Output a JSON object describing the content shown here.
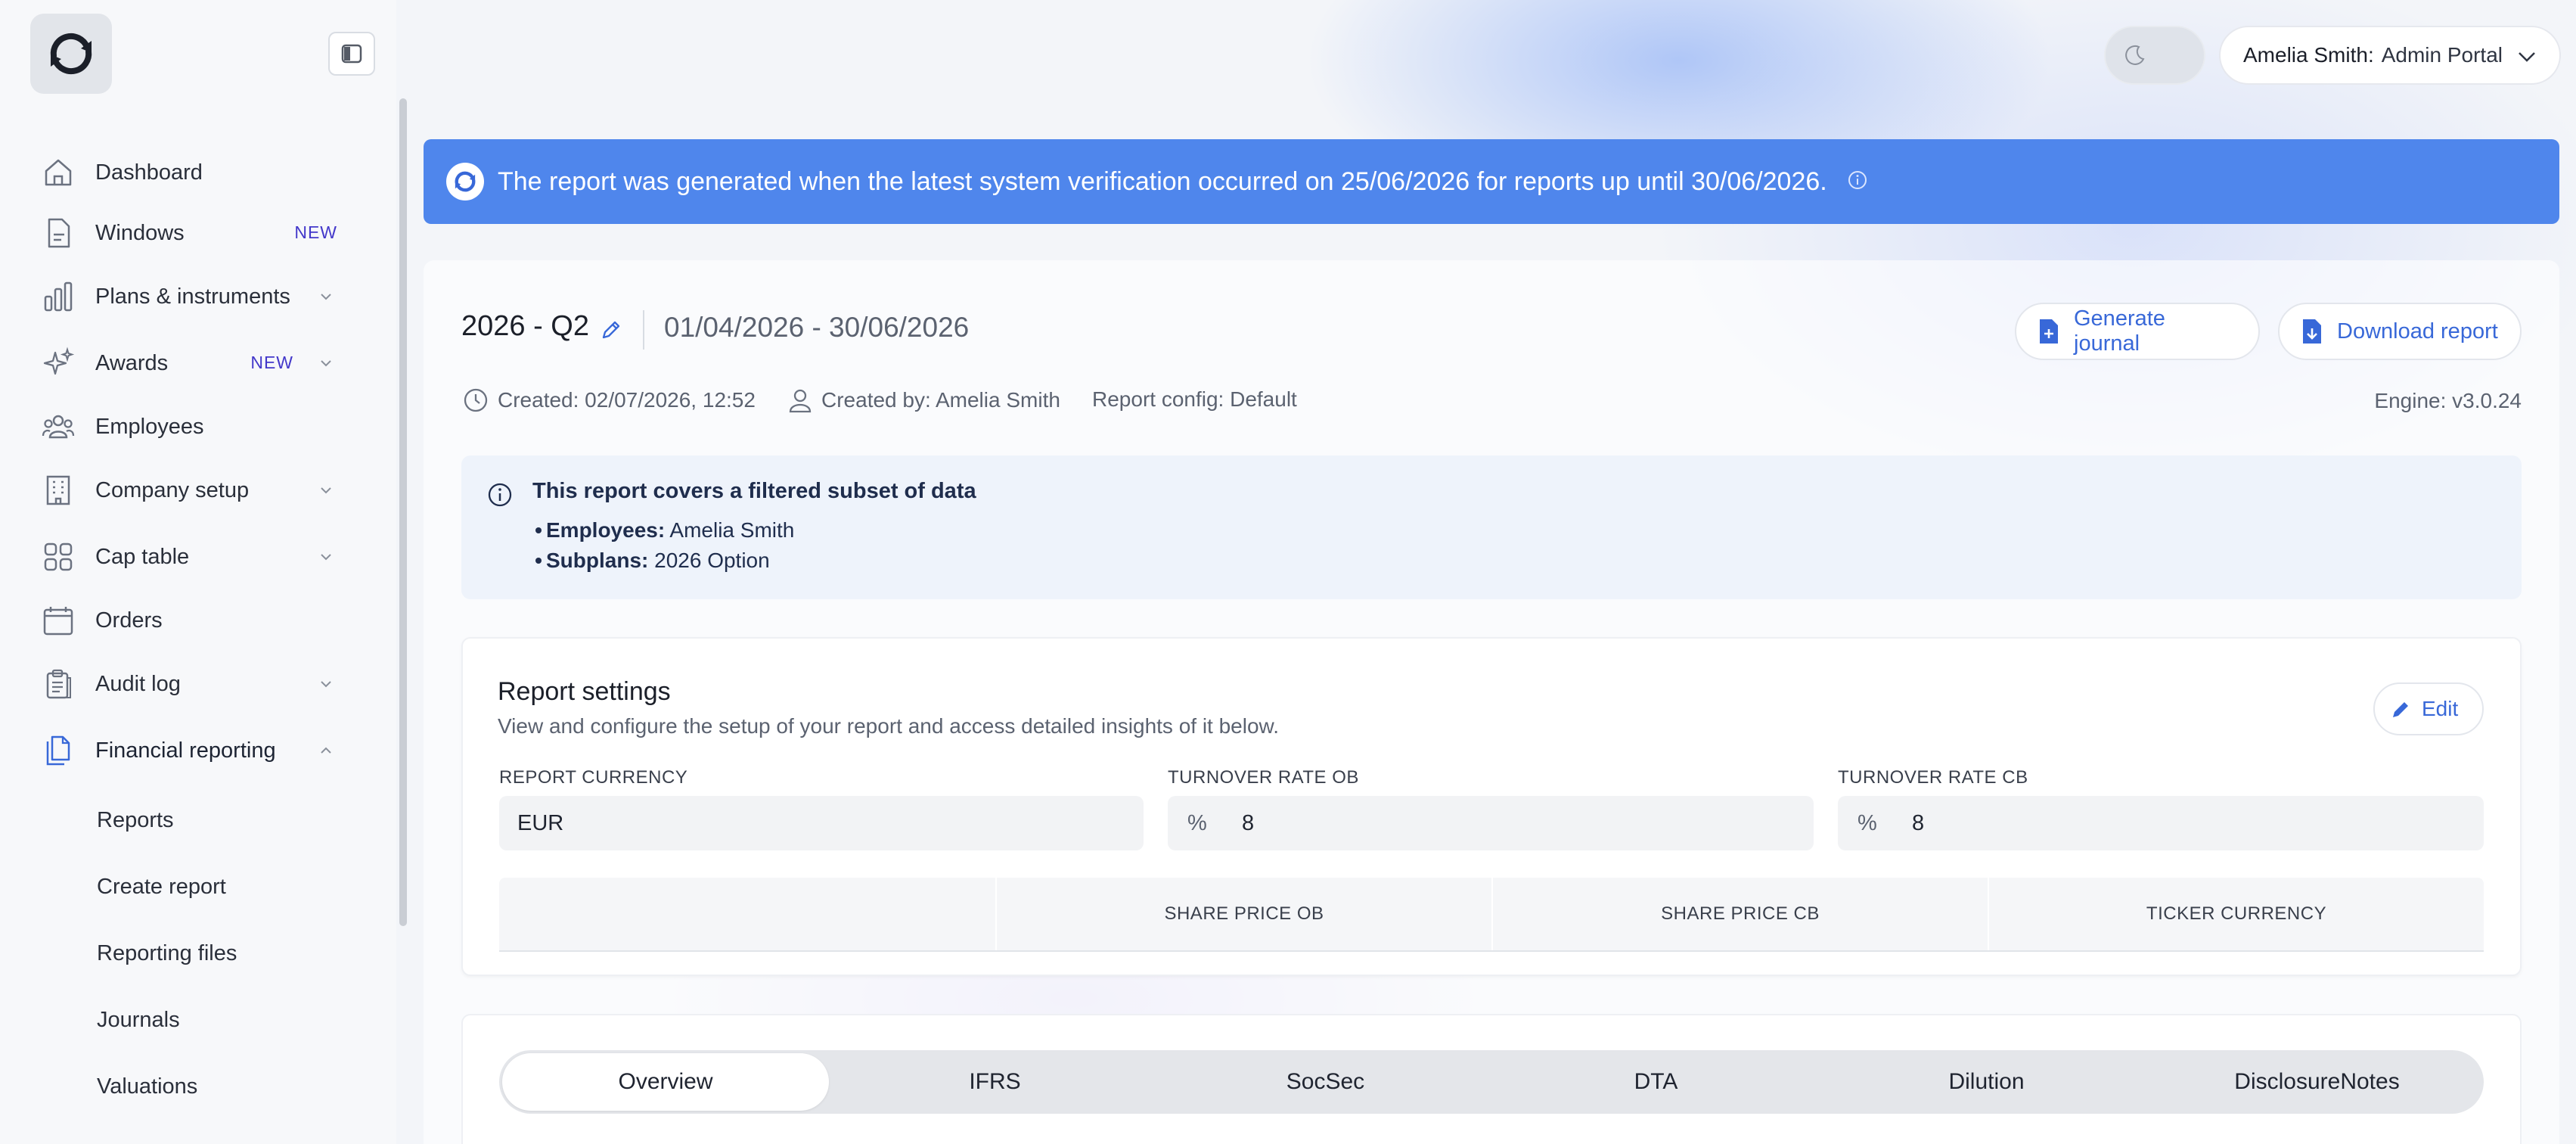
{
  "sidebar": {
    "items": [
      {
        "label": "Dashboard",
        "icon": "home-icon"
      },
      {
        "label": "Windows",
        "icon": "document-icon",
        "badge": "NEW"
      },
      {
        "label": "Plans & instruments",
        "icon": "bar-chart-icon"
      },
      {
        "label": "Awards",
        "icon": "sparkles-icon",
        "badge": "NEW"
      },
      {
        "label": "Employees",
        "icon": "users-icon"
      },
      {
        "label": "Company setup",
        "icon": "building-icon"
      },
      {
        "label": "Cap table",
        "icon": "grid-icon"
      },
      {
        "label": "Orders",
        "icon": "calendar-icon"
      },
      {
        "label": "Audit log",
        "icon": "clipboard-icon"
      },
      {
        "label": "Financial reporting",
        "icon": "files-icon"
      }
    ],
    "subitems": [
      "Reports",
      "Create report",
      "Reporting files",
      "Journals",
      "Valuations"
    ]
  },
  "header": {
    "user_name": "Amelia Smith:",
    "portal": "Admin Portal"
  },
  "banner": {
    "text": "The report was generated when the latest system verification occurred on 25/06/2026 for reports up until 30/06/2026."
  },
  "report": {
    "period": "2026 - Q2",
    "range": "01/04/2026 - 30/06/2026",
    "generate_journal": "Generate journal",
    "download_report": "Download report",
    "created": "Created: 02/07/2026, 12:52",
    "created_by": "Created by: Amelia Smith",
    "config": "Report config: Default",
    "engine": "Engine: v3.0.24"
  },
  "filter": {
    "title": "This report covers a filtered subset of data",
    "employees_label": "Employees:",
    "employees_value": "Amelia Smith",
    "subplans_label": "Subplans:",
    "subplans_value": "2026 Option"
  },
  "settings": {
    "title": "Report settings",
    "subtitle": "View and configure the setup of your report and access detailed insights of it below.",
    "edit": "Edit",
    "currency_label": "REPORT CURRENCY",
    "currency_value": "EUR",
    "turnover_ob_label": "TURNOVER RATE OB",
    "turnover_ob_value": "8",
    "turnover_cb_label": "TURNOVER RATE CB",
    "turnover_cb_value": "8",
    "percent": "%",
    "table_headers": [
      "",
      "SHARE PRICE OB",
      "SHARE PRICE CB",
      "TICKER CURRENCY"
    ]
  },
  "tabs": [
    "Overview",
    "IFRS",
    "SocSec",
    "DTA",
    "Dilution",
    "DisclosureNotes"
  ],
  "colors": {
    "accent": "#3868d8",
    "banner": "#4f86ec",
    "badge": "#4338ca"
  }
}
